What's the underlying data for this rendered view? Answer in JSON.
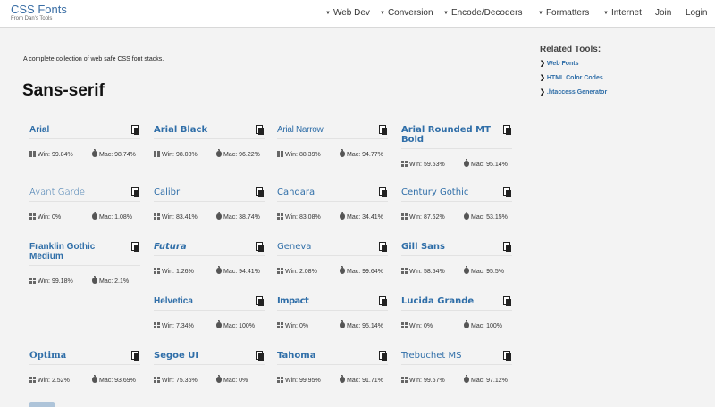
{
  "brand": {
    "title": "CSS Fonts",
    "subtitle": "From Dan's Tools"
  },
  "nav": {
    "items": [
      {
        "label": "Web Dev"
      },
      {
        "label": "Conversion"
      },
      {
        "label": "Encode/Decoders"
      },
      {
        "label": "Formatters"
      },
      {
        "label": "Internet"
      }
    ],
    "join": "Join",
    "login": "Login"
  },
  "intro": "A complete collection of web safe CSS font stacks.",
  "heading": "Sans-serif",
  "related": {
    "title": "Related Tools:",
    "items": [
      {
        "label": "Web Fonts"
      },
      {
        "label": "HTML Color Codes"
      },
      {
        "label": ".htaccess Generator"
      }
    ]
  },
  "fonts": [
    {
      "name": "Arial",
      "win": "Win: 99.84%",
      "mac": "Mac: 98.74%"
    },
    {
      "name": "Arial Black",
      "win": "Win: 98.08%",
      "mac": "Mac: 96.22%"
    },
    {
      "name": "Arial Narrow",
      "win": "Win: 88.39%",
      "mac": "Mac: 94.77%"
    },
    {
      "name": "Arial Rounded MT Bold",
      "win": "Win: 59.53%",
      "mac": "Mac: 95.14%"
    },
    {
      "name": "Avant Garde",
      "win": "Win: 0%",
      "mac": "Mac: 1.08%"
    },
    {
      "name": "Calibri",
      "win": "Win: 83.41%",
      "mac": "Mac: 38.74%"
    },
    {
      "name": "Candara",
      "win": "Win: 83.08%",
      "mac": "Mac: 34.41%"
    },
    {
      "name": "Century Gothic",
      "win": "Win: 87.62%",
      "mac": "Mac: 53.15%"
    },
    {
      "name": "Franklin Gothic Medium",
      "win": "Win: 99.18%",
      "mac": "Mac: 2.1%"
    },
    {
      "name": "Futura",
      "win": "Win: 1.26%",
      "mac": "Mac: 94.41%"
    },
    {
      "name": "Geneva",
      "win": "Win: 2.08%",
      "mac": "Mac: 99.64%"
    },
    {
      "name": "Gill Sans",
      "win": "Win: 58.54%",
      "mac": "Mac: 95.5%"
    },
    {
      "name": "Helvetica",
      "win": "Win: 7.34%",
      "mac": "Mac: 100%"
    },
    {
      "name": "Impact",
      "win": "Win: 0%",
      "mac": "Mac: 95.14%"
    },
    {
      "name": "Lucida Grande",
      "win": "Win: 0%",
      "mac": "Mac: 100%"
    },
    {
      "name": "Optima",
      "win": "Win: 2.52%",
      "mac": "Mac: 93.69%"
    },
    {
      "name": "Segoe UI",
      "win": "Win: 75.36%",
      "mac": "Mac: 0%"
    },
    {
      "name": "Tahoma",
      "win": "Win: 99.95%",
      "mac": "Mac: 91.71%"
    },
    {
      "name": "Trebuchet MS",
      "win": "Win: 99.67%",
      "mac": "Mac: 97.12%"
    }
  ],
  "colors": {
    "link": "#2f6ea8",
    "background": "#f3f3f3"
  },
  "icons": {
    "copy": "copy-icon",
    "windows": "windows-icon",
    "apple": "apple-icon",
    "caret": "caret-down-icon",
    "chevron": "chevron-right-icon"
  }
}
